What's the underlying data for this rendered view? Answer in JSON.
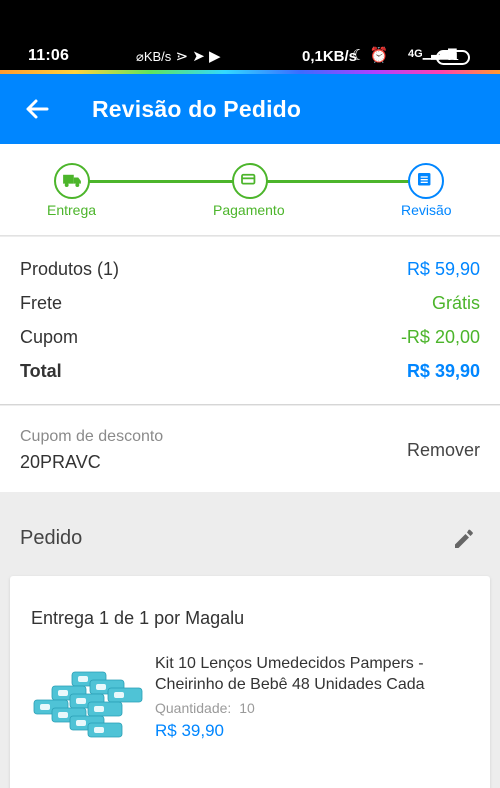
{
  "status_bar": {
    "time": "11:06",
    "left_icons": "0.1 KB/s",
    "net_speed": "0,1KB/s",
    "signal": "4G",
    "battery": "71"
  },
  "app_bar": {
    "title": "Revisão do Pedido",
    "back_icon": "arrow-left-icon"
  },
  "stepper": {
    "steps": [
      {
        "label": "Entrega",
        "icon": "truck-icon",
        "state": "done"
      },
      {
        "label": "Pagamento",
        "icon": "card-icon",
        "state": "done"
      },
      {
        "label": "Revisão",
        "icon": "list-icon",
        "state": "current"
      }
    ],
    "colors": {
      "done": "#4cb52b",
      "current": "#0086ff"
    }
  },
  "summary": {
    "products_label": "Produtos (1)",
    "products_value": "R$ 59,90",
    "shipping_label": "Frete",
    "shipping_value": "Grátis",
    "coupon_label": "Cupom",
    "coupon_value": "-R$ 20,00",
    "total_label": "Total",
    "total_value": "R$ 39,90"
  },
  "coupon": {
    "label": "Cupom de desconto",
    "code": "20PRAVC",
    "remove_label": "Remover"
  },
  "order": {
    "title": "Pedido",
    "edit_icon": "pencil-icon",
    "delivery_label": "Entrega 1 de 1 por Magalu",
    "item": {
      "name": "Kit 10 Lenços Umedecidos Pampers - Cheirinho de Bebê 48 Unidades Cada",
      "quantity_label": "Quantidade:",
      "quantity_value": "10",
      "price": "R$ 39,90"
    }
  },
  "colors": {
    "brand_blue": "#0086ff",
    "success_green": "#4cb52b"
  }
}
